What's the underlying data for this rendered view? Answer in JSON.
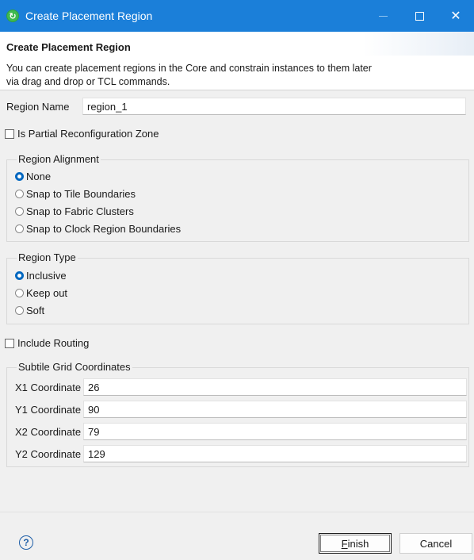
{
  "window": {
    "title": "Create Placement Region"
  },
  "header": {
    "title": "Create Placement Region",
    "description": "You can create placement regions in the Core and constrain instances to them later via drag and drop or TCL commands."
  },
  "form": {
    "region_name_label": "Region Name",
    "region_name_value": "region_1",
    "partial_reconfig_label": "Is Partial Reconfiguration Zone",
    "partial_reconfig_checked": false,
    "include_routing_label": "Include Routing",
    "include_routing_checked": false
  },
  "alignment": {
    "legend": "Region Alignment",
    "options": [
      {
        "label": "None",
        "selected": true
      },
      {
        "label": "Snap to Tile Boundaries",
        "selected": false
      },
      {
        "label": "Snap to Fabric Clusters",
        "selected": false
      },
      {
        "label": "Snap to Clock Region Boundaries",
        "selected": false
      }
    ]
  },
  "region_type": {
    "legend": "Region Type",
    "options": [
      {
        "label": "Inclusive",
        "selected": true
      },
      {
        "label": "Keep out",
        "selected": false
      },
      {
        "label": "Soft",
        "selected": false
      }
    ]
  },
  "coords": {
    "legend": "Subtile Grid Coordinates",
    "rows": [
      {
        "label": "X1 Coordinate",
        "value": "26"
      },
      {
        "label": "Y1 Coordinate",
        "value": "90"
      },
      {
        "label": "X2 Coordinate",
        "value": "79"
      },
      {
        "label": "Y2 Coordinate",
        "value": "129"
      }
    ]
  },
  "footer": {
    "help_symbol": "?",
    "finish_mnemonic": "F",
    "finish_rest": "inish",
    "cancel_label": "Cancel"
  },
  "colors": {
    "titlebar": "#1b7fd9",
    "radio_selected": "#0067c0"
  }
}
